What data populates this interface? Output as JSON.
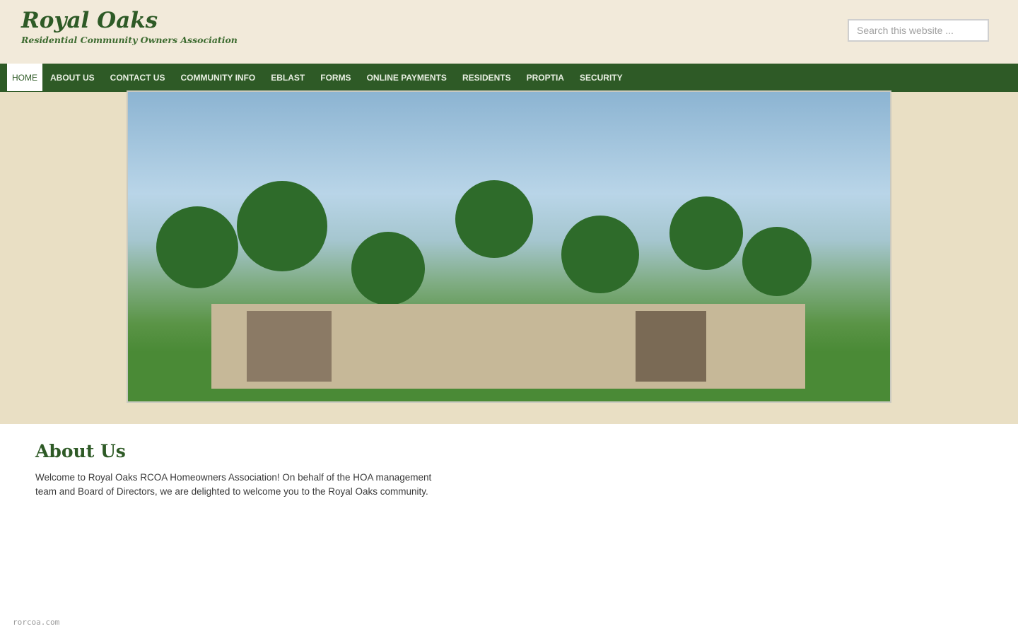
{
  "header": {
    "site_title": "Royal Oaks",
    "tagline": "Residential Community Owners Association",
    "search_placeholder": "Search this website ..."
  },
  "nav": {
    "items": [
      {
        "label": "HOME",
        "active": true
      },
      {
        "label": "ABOUT US"
      },
      {
        "label": "CONTACT US"
      },
      {
        "label": "COMMUNITY INFO"
      },
      {
        "label": "EBLAST"
      },
      {
        "label": "FORMS"
      },
      {
        "label": "ONLINE PAYMENTS"
      },
      {
        "label": "RESIDENTS"
      },
      {
        "label": "PROPTIA"
      },
      {
        "label": "SECURITY"
      }
    ]
  },
  "main": {
    "heading": "About Us",
    "intro": "Welcome to Royal Oaks RCOA Homeowners Association! On behalf of the HOA management team and Board of Directors, we are delighted to welcome you to the Royal Oaks community."
  },
  "footer": {
    "domain": "rorcoa.com"
  },
  "colors": {
    "brand_green": "#2e5a26",
    "header_bg": "#f2eada",
    "hero_band_bg": "#e9dfc4"
  }
}
